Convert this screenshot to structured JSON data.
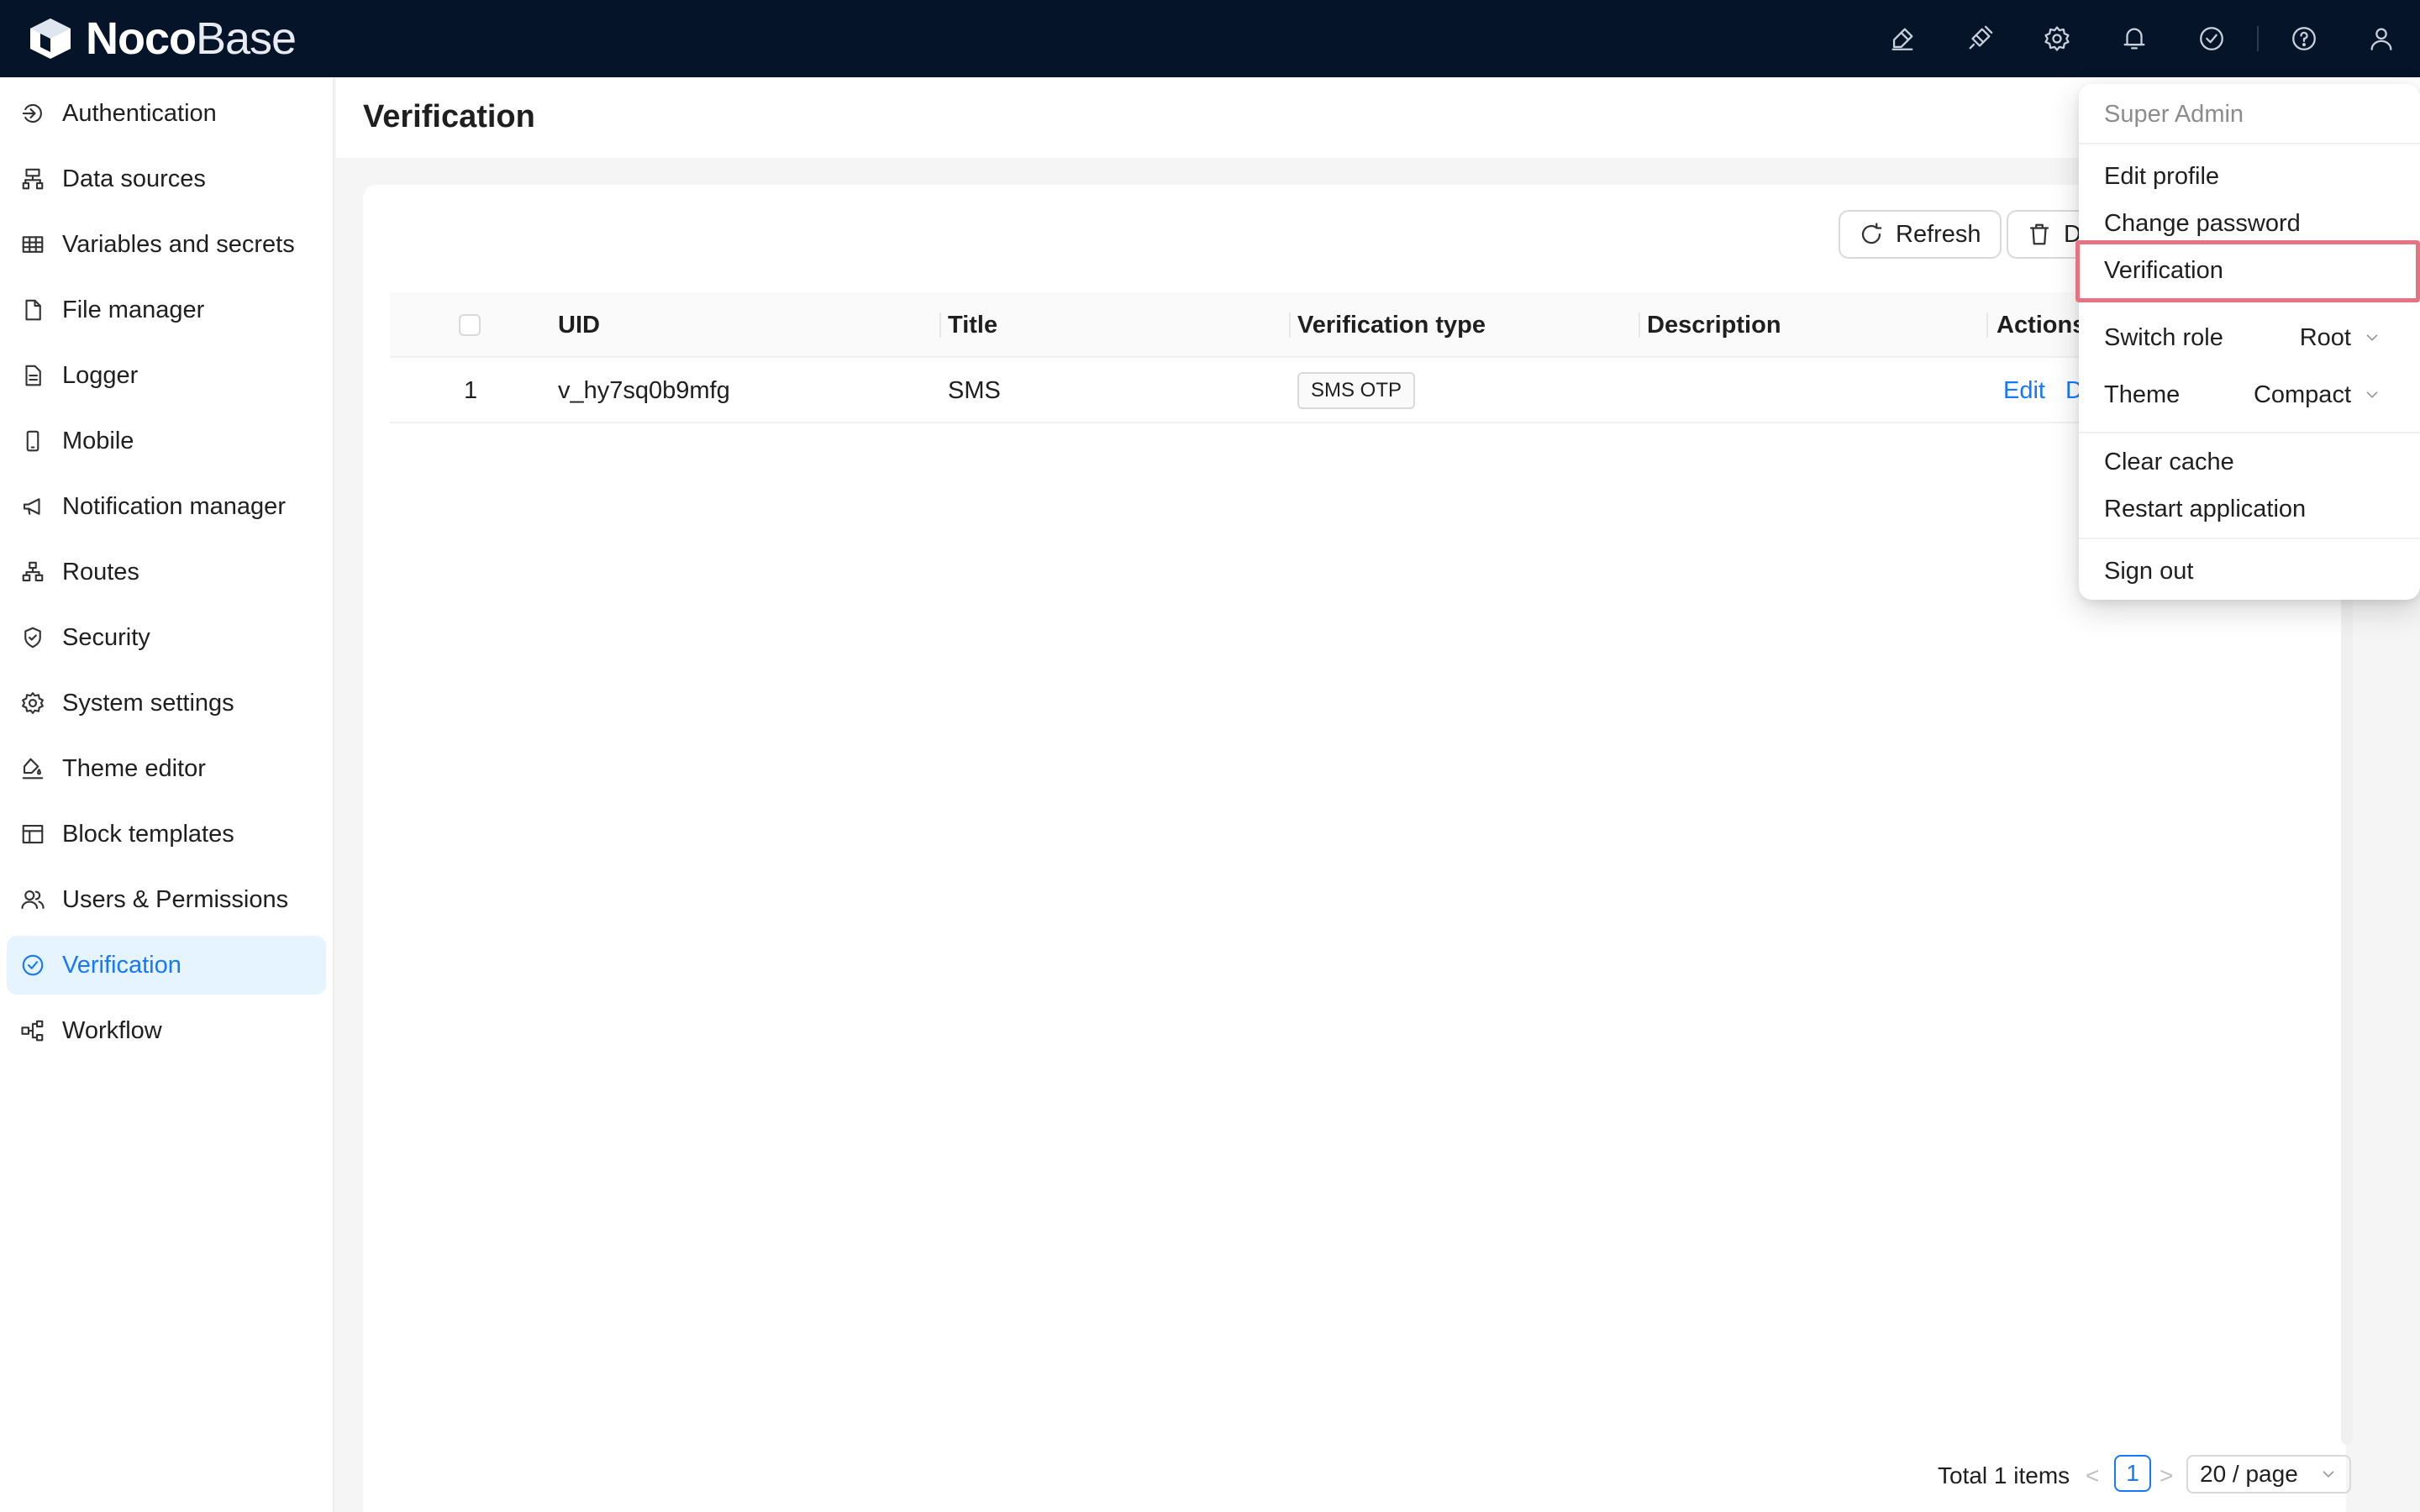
{
  "app": {
    "logo_bold": "Noco",
    "logo_light": "Base",
    "brand_color": "#051428",
    "accent_color": "#1677ff"
  },
  "topbar": {
    "icons": [
      "theme-editor-icon",
      "plugin-icon",
      "settings-icon",
      "bell-icon",
      "check-circle-icon",
      "help-icon",
      "user-icon"
    ]
  },
  "sidebar": {
    "items": [
      {
        "label": "Authentication",
        "icon": "login-icon"
      },
      {
        "label": "Data sources",
        "icon": "database-icon"
      },
      {
        "label": "Variables and secrets",
        "icon": "table-icon"
      },
      {
        "label": "File manager",
        "icon": "file-icon"
      },
      {
        "label": "Logger",
        "icon": "file-text-icon"
      },
      {
        "label": "Mobile",
        "icon": "mobile-icon"
      },
      {
        "label": "Notification manager",
        "icon": "megaphone-icon"
      },
      {
        "label": "Routes",
        "icon": "routes-icon"
      },
      {
        "label": "Security",
        "icon": "shield-icon"
      },
      {
        "label": "System settings",
        "icon": "gear-icon"
      },
      {
        "label": "Theme editor",
        "icon": "paint-icon"
      },
      {
        "label": "Block templates",
        "icon": "layout-icon"
      },
      {
        "label": "Users & Permissions",
        "icon": "users-icon"
      },
      {
        "label": "Verification",
        "icon": "check-circle-icon",
        "active": true
      },
      {
        "label": "Workflow",
        "icon": "workflow-icon"
      }
    ]
  },
  "page": {
    "title": "Verification"
  },
  "toolbar": {
    "refresh_label": "Refresh",
    "delete_label": "D"
  },
  "table": {
    "columns": [
      "UID",
      "Title",
      "Verification type",
      "Description",
      "Actions"
    ],
    "rows": [
      {
        "index": "1",
        "uid": "v_hy7sq0b9mfg",
        "title": "SMS",
        "type": "SMS OTP",
        "description": "",
        "edit": "Edit",
        "delete": "D"
      }
    ]
  },
  "pagination": {
    "total": "Total 1 items",
    "prev": "<",
    "current": "1",
    "next": ">",
    "page_size": "20 / page"
  },
  "user_menu": {
    "user_name": "Super Admin",
    "edit_profile": "Edit profile",
    "change_password": "Change password",
    "verification": "Verification",
    "switch_role": "Switch role",
    "switch_role_value": "Root",
    "theme": "Theme",
    "theme_value": "Compact",
    "clear_cache": "Clear cache",
    "restart_application": "Restart application",
    "sign_out": "Sign out",
    "highlight_color": "#e57384"
  }
}
